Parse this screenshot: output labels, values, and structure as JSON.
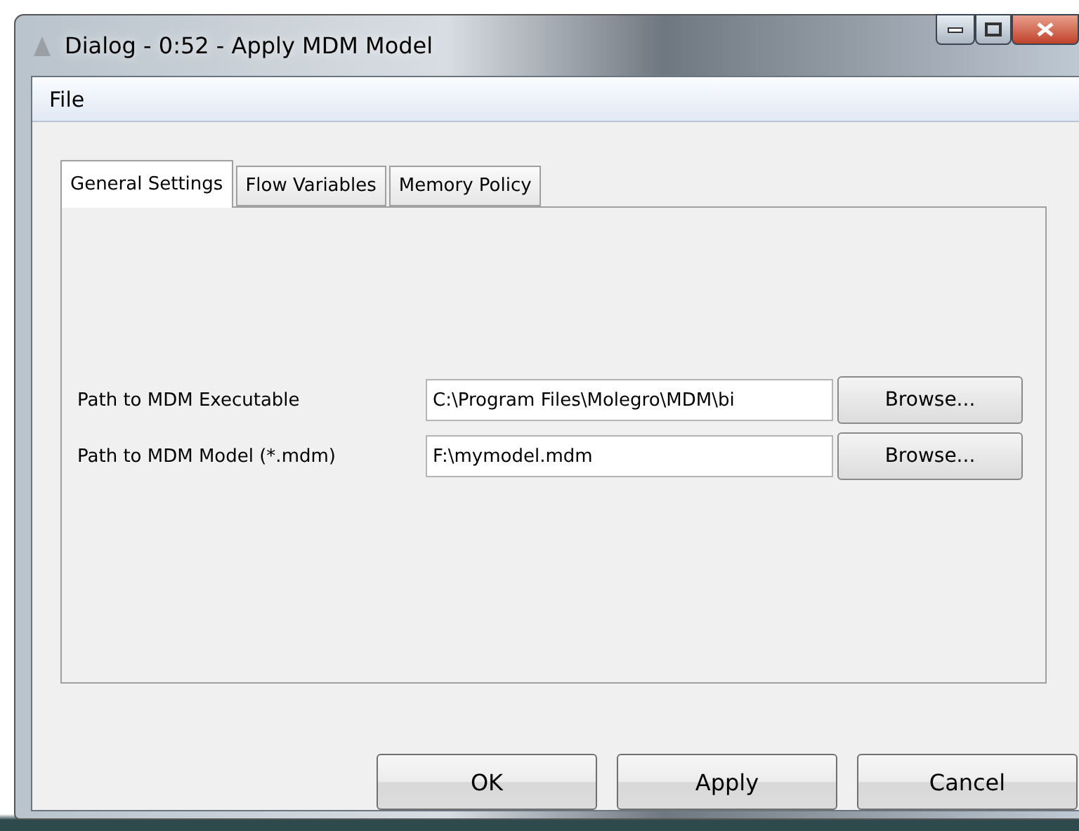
{
  "window": {
    "title": "Dialog - 0:52 - Apply MDM Model"
  },
  "menu": [
    "File"
  ],
  "tabs": [
    {
      "label": "General Settings",
      "selected": true
    },
    {
      "label": "Flow Variables",
      "selected": false
    },
    {
      "label": "Memory Policy",
      "selected": false
    }
  ],
  "fields": [
    {
      "label": "Path to MDM Executable",
      "value": "C:\\Program Files\\Molegro\\MDM\\bi",
      "button": "Browse..."
    },
    {
      "label": "Path to MDM Model (*.mdm)",
      "value": "F:\\mymodel.mdm",
      "button": "Browse..."
    }
  ],
  "buttons": [
    "OK",
    "Apply",
    "Cancel"
  ]
}
